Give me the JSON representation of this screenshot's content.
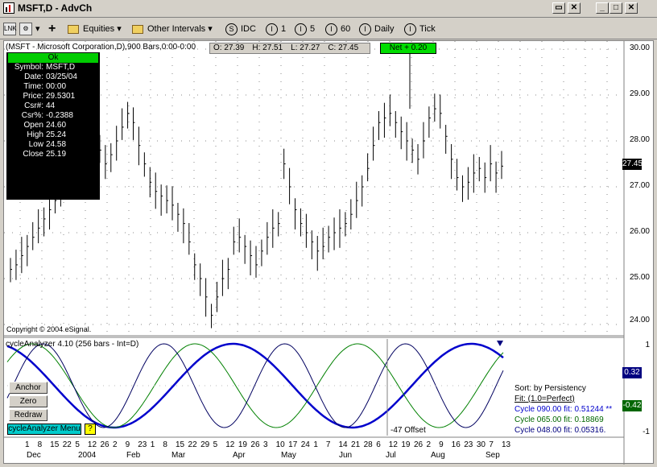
{
  "window": {
    "title": "MSFT,D - AdvCh"
  },
  "toolbar": {
    "equities": "Equities",
    "other_intervals": "Other Intervals",
    "intervals": [
      {
        "icon": "S",
        "label": "IDC"
      },
      {
        "icon": "I",
        "label": "1"
      },
      {
        "icon": "I",
        "label": "5"
      },
      {
        "icon": "I",
        "label": "60"
      },
      {
        "icon": "I",
        "label": "Daily"
      },
      {
        "icon": "I",
        "label": "Tick"
      }
    ]
  },
  "chart": {
    "header": "(MSFT - Microsoft Corporation,D),900 Bars,0:00-0:00",
    "ohlc": {
      "open": "O: 27.39",
      "high": "H: 27.51",
      "low": "L: 27.27",
      "close": "C: 27.45"
    },
    "net": "Net + 0.20",
    "copyright": "Copyright © 2004 eSignal.",
    "price_labels": [
      "30.00",
      "29.00",
      "28.00",
      "27.00",
      "26.00",
      "25.00",
      "24.00"
    ],
    "last_price": "27.45",
    "price_color": "#000000",
    "up_color": "#000000"
  },
  "databox": {
    "status": "Ok",
    "rows": [
      {
        "k": "Symbol:",
        "v": "MSFT,D"
      },
      {
        "k": "Date:",
        "v": "03/25/04"
      },
      {
        "k": "Time:",
        "v": "00:00"
      },
      {
        "k": "Price:",
        "v": "29.5301"
      },
      {
        "k": "Csr#:",
        "v": "44"
      },
      {
        "k": "Csr%:",
        "v": "-0.2388"
      },
      {
        "k": "Open",
        "v": "24.60"
      },
      {
        "k": "High",
        "v": "25.24"
      },
      {
        "k": "Low",
        "v": "24.58"
      },
      {
        "k": "Close",
        "v": "25.19"
      }
    ]
  },
  "cycle": {
    "title": "cycleAnalyzer 4.10 (256 bars - Int=D)",
    "buttons": [
      "Anchor",
      "Zero",
      "Redraw"
    ],
    "menu": "cycleAnalyzer Menu",
    "help": "?",
    "offset": "-47 Offset",
    "sort": "Sort: by Persistency",
    "fit": "Fit: (1.0=Perfect)",
    "cycles": [
      {
        "label": "Cycle 090.00 fit: 0.51244 **",
        "color": "#0000cc"
      },
      {
        "label": "Cycle 065.00 fit: 0.18869",
        "color": "#006600"
      },
      {
        "label": "Cycle 048.00 fit: 0.05316.",
        "color": "#000080"
      }
    ],
    "y_labels": [
      "1",
      "-1"
    ],
    "badge_pos": "0.32",
    "badge_neg": "-0.42",
    "badge_pos_color": "#000080",
    "badge_neg_color": "#006600"
  },
  "x_axis": {
    "days": [
      "1",
      "8",
      "15",
      "22",
      "5",
      "12",
      "26",
      "2",
      "9",
      "23",
      "1",
      "8",
      "15",
      "22",
      "29",
      "5",
      "12",
      "19",
      "26",
      "3",
      "10",
      "17",
      "24",
      "1",
      "7",
      "14",
      "21",
      "28",
      "6",
      "12",
      "19",
      "26",
      "2",
      "9",
      "16",
      "23",
      "30",
      "7",
      "13"
    ],
    "months": [
      "Dec",
      "2004",
      "Feb",
      "Mar",
      "Apr",
      "May",
      "Jun",
      "Jul",
      "Aug",
      "Sep"
    ]
  },
  "price_series": [
    25.2,
    25.3,
    25.5,
    25.7,
    25.9,
    26.1,
    26.3,
    26.5,
    26.7,
    26.9,
    27.1,
    27.3,
    27.5,
    27.6,
    27.4,
    27.6,
    27.8,
    27.5,
    27.7,
    28.0,
    28.3,
    28.6,
    28.4,
    27.9,
    27.5,
    27.1,
    26.9,
    26.8,
    26.7,
    26.6,
    26.4,
    26.2,
    25.8,
    25.3,
    25.0,
    24.6,
    24.2,
    24.6,
    25.0,
    25.2,
    25.8,
    25.9,
    25.7,
    25.5,
    25.3,
    25.6,
    25.9,
    26.1,
    26.2,
    27.5,
    27.0,
    26.5,
    26.2,
    26.0,
    25.8,
    25.6,
    25.7,
    25.9,
    26.0,
    26.1,
    26.2,
    26.4,
    26.7,
    27.0,
    27.4,
    27.9,
    28.4,
    28.5,
    28.6,
    28.4,
    28.2,
    28.0,
    27.8,
    27.6,
    28.0,
    28.5,
    28.7,
    28.6,
    28.1,
    27.6,
    27.2,
    27.0,
    27.1,
    27.3,
    27.4,
    27.2,
    27.5,
    27.3,
    27.45
  ]
}
